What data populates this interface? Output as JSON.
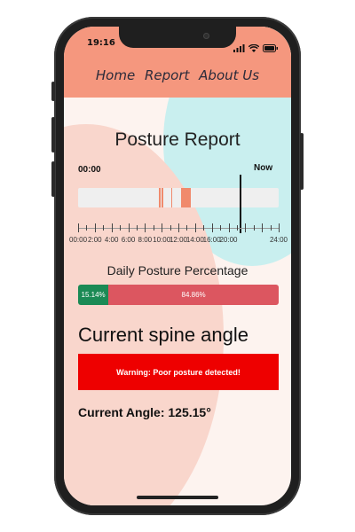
{
  "status_bar": {
    "time": "19:16",
    "icons": [
      "signal-icon",
      "wifi-icon",
      "battery-icon"
    ]
  },
  "nav": {
    "items": [
      "Home",
      "Report",
      "About Us"
    ]
  },
  "report": {
    "title": "Posture Report",
    "timeline": {
      "start_label": "00:00",
      "end_label": "Now",
      "tick_labels": [
        "00:00",
        "2:00",
        "4:00",
        "6:00",
        "8:00",
        "10:00",
        "12:00",
        "14:00",
        "16:00",
        "20:00",
        "24:00"
      ],
      "event_hours": [
        9.7,
        10.0,
        11.1,
        12.3,
        12.4,
        12.5,
        12.6,
        12.7,
        12.8,
        12.9,
        13.0,
        13.1,
        13.2,
        13.3
      ],
      "now_hour": 19.3
    }
  },
  "daily": {
    "title": "Daily Posture Percentage",
    "good_percent": 15.14,
    "bad_percent": 84.86,
    "good_label": "15.14%",
    "bad_label": "84.86%"
  },
  "spine": {
    "title": "Current spine angle",
    "warning": "Warning: Poor posture detected!",
    "angle_text": "Current Angle: 125.15°"
  },
  "colors": {
    "header": "#f5977e",
    "event": "#f08a6c",
    "good": "#1b8a55",
    "bad": "#dc5660",
    "warning": "#ee0000"
  }
}
